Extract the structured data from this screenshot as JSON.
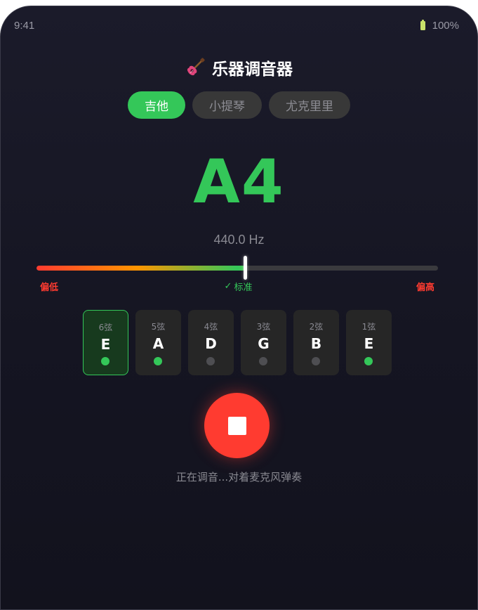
{
  "status_bar": {
    "time": "9:41",
    "battery": "100%",
    "battery_icon": "battery-icon"
  },
  "header": {
    "icon": "guitar-icon",
    "title": "乐器调音器"
  },
  "instrument_tabs": [
    {
      "label": "吉他",
      "active": true
    },
    {
      "label": "小提琴",
      "active": false
    },
    {
      "label": "尤克里里",
      "active": false
    }
  ],
  "tuner": {
    "note": "A4",
    "frequency": "440.0 Hz",
    "meter_level": 0.52,
    "labels": {
      "low": "偏低",
      "in_tune": "标准",
      "high": "偏高"
    }
  },
  "strings": [
    {
      "number": "6弦",
      "note": "E",
      "tuned": true,
      "active": true
    },
    {
      "number": "5弦",
      "note": "A",
      "tuned": true,
      "active": false
    },
    {
      "number": "4弦",
      "note": "D",
      "tuned": false,
      "active": false
    },
    {
      "number": "3弦",
      "note": "G",
      "tuned": false,
      "active": false
    },
    {
      "number": "2弦",
      "note": "B",
      "tuned": false,
      "active": false
    },
    {
      "number": "1弦",
      "note": "E",
      "tuned": true,
      "active": false
    }
  ],
  "control": {
    "icon": "stop-icon",
    "status": "正在调音...对着麦克风弹奏"
  },
  "colors": {
    "accent": "#34c759",
    "danger": "#ff3b30",
    "warning": "#ff9500",
    "background": "#1b1b2a"
  }
}
